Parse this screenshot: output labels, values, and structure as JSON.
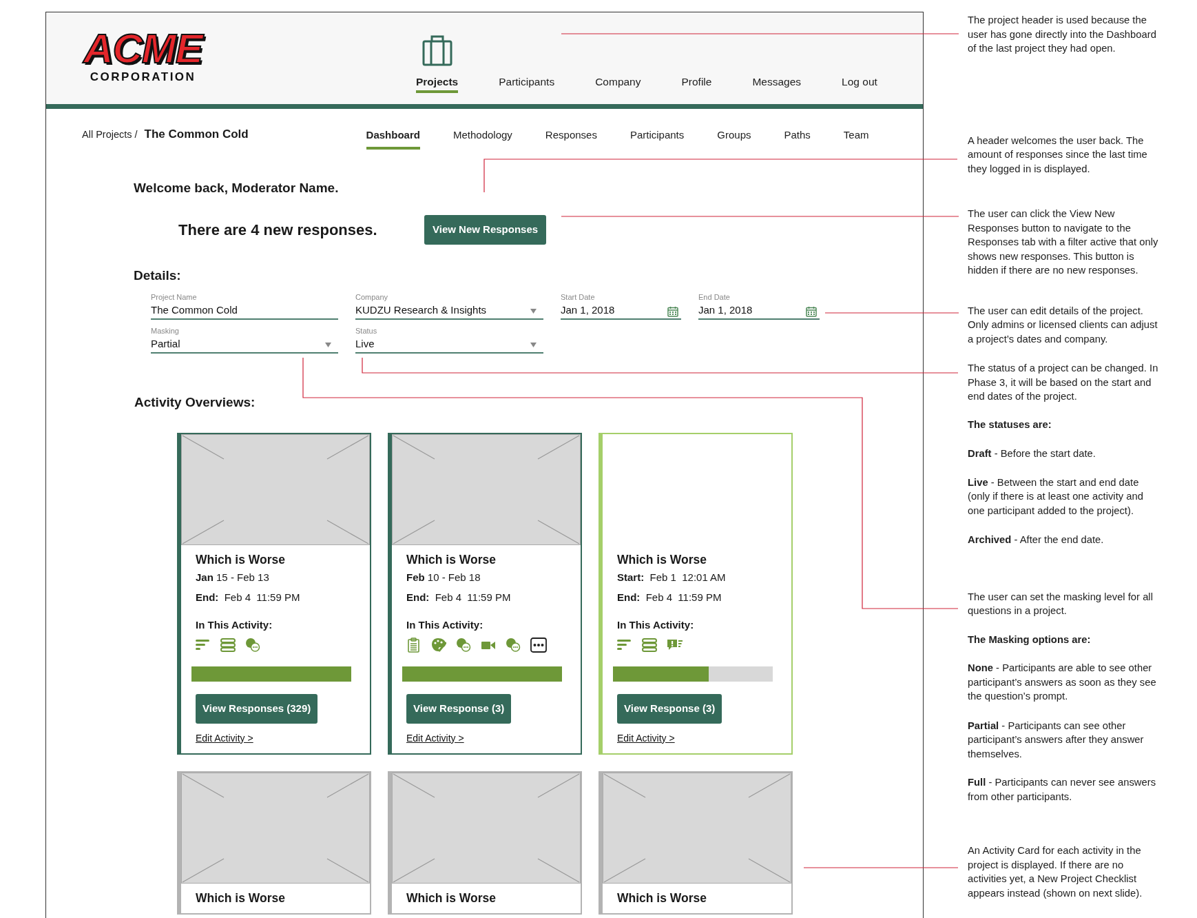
{
  "logo": {
    "line1": "ACME",
    "line2": "CORPORATION"
  },
  "main_nav": [
    {
      "label": "Projects",
      "selected": true
    },
    {
      "label": "Participants",
      "selected": false
    },
    {
      "label": "Company",
      "selected": false
    },
    {
      "label": "Profile",
      "selected": false
    },
    {
      "label": "Messages",
      "selected": false
    },
    {
      "label": "Log out",
      "selected": false
    }
  ],
  "breadcrumb": {
    "parent": "All Projects /",
    "current": "The Common Cold"
  },
  "project_tabs": [
    {
      "label": "Dashboard",
      "selected": true
    },
    {
      "label": "Methodology",
      "selected": false
    },
    {
      "label": "Responses",
      "selected": false
    },
    {
      "label": "Participants",
      "selected": false
    },
    {
      "label": "Groups",
      "selected": false
    },
    {
      "label": "Paths",
      "selected": false
    },
    {
      "label": "Team",
      "selected": false
    }
  ],
  "welcome": "Welcome back, Moderator Name.",
  "new_responses": {
    "text": "There are 4 new responses.",
    "button": "View New Responses"
  },
  "details": {
    "title": "Details:",
    "fields": [
      {
        "label": "Project Name",
        "value": "The Common Cold",
        "kind": "text"
      },
      {
        "label": "Company",
        "value": "KUDZU Research & Insights",
        "kind": "select"
      },
      {
        "label": "Start Date",
        "value": "Jan 1, 2018",
        "kind": "date"
      },
      {
        "label": "End Date",
        "value": "Jan 1, 2018",
        "kind": "date"
      },
      {
        "label": "Masking",
        "value": "Partial",
        "kind": "select"
      },
      {
        "label": "Status",
        "value": "Live",
        "kind": "select"
      }
    ]
  },
  "activity_overviews": {
    "title": "Activity Overviews:",
    "cards": [
      {
        "color": "#356a5a",
        "image": true,
        "title": "Which is Worse",
        "dates": "**Jan** 15 - Feb 13",
        "end": "**End:**  Feb 4  11:59 PM",
        "contents_label": "In This Activity:",
        "icons": [
          {
            "kind": "bars"
          },
          {
            "kind": "stack"
          },
          {
            "kind": "question"
          }
        ],
        "level": 1,
        "button": "View Responses (329)",
        "link": "Edit Activity >"
      },
      {
        "color": "#356a5a",
        "image": true,
        "title": "Which is Worse",
        "dates": "**Feb** 10 - Feb 18",
        "end": "**End:**  Feb 4  11:59 PM",
        "contents_label": "In This Activity:",
        "icons": [
          {
            "kind": "clipboard"
          },
          {
            "kind": "palette"
          },
          {
            "kind": "question"
          },
          {
            "kind": "video"
          },
          {
            "kind": "question"
          },
          {
            "kind": "more"
          }
        ],
        "level": 1,
        "button": "View Response (3)",
        "link": "Edit Activity >"
      },
      {
        "color": "#a5cf6a",
        "image": false,
        "title": "Which is Worse",
        "dates": "**Start:**  Feb 1  12:01 AM",
        "end": "**End:**  Feb 4  11:59 PM",
        "contents_label": "In This Activity:",
        "icons": [
          {
            "kind": "bars"
          },
          {
            "kind": "stack"
          },
          {
            "kind": "alert"
          }
        ],
        "level": 0.6,
        "button": "View Response (3)",
        "link": "Edit Activity >"
      },
      {
        "color": "#b3b3b3",
        "image": true,
        "title": "Which is Worse"
      },
      {
        "color": "#b3b3b3",
        "image": true,
        "title": "Which is Worse"
      },
      {
        "color": "#b3b3b3",
        "image": true,
        "title": "Which is Worse"
      }
    ]
  },
  "notes": [
    {
      "kind": "note",
      "text": "The project header is used because the user has gone directly into the Dashboard of the last project they had open."
    },
    {
      "kind": "note",
      "text": "A header welcomes the user back. The amount of responses since the last time they logged in is displayed."
    },
    {
      "kind": "note",
      "text": "The user can click the View New Responses button to navigate to the Responses tab with a filter active that only shows new responses. This button is hidden if there are no new responses."
    },
    {
      "kind": "note",
      "text": "The user can edit details of the project. Only admins or licensed clients can adjust a project’s dates and company."
    },
    {
      "kind": "note",
      "text": "The status of a project can be changed. In Phase 3, it will be based on the start and end dates of the project."
    },
    {
      "kind": "heading",
      "text": "The statuses are:"
    },
    {
      "kind": "note",
      "text": "**Draft** - Before the start date."
    },
    {
      "kind": "note",
      "text": "**Live** - Between the start and end date (only if there is at least one activity and one participant added to the project)."
    },
    {
      "kind": "note",
      "text": "**Archived** - After the end date."
    },
    {
      "kind": "note",
      "text": "The user can set the masking level for all questions in a project."
    },
    {
      "kind": "heading",
      "text": "The Masking options are:"
    },
    {
      "kind": "note",
      "text": "**None** - Participants are able to see other participant’s answers as soon as they see the question’s prompt."
    },
    {
      "kind": "note",
      "text": "**Partial** - Participants can see other participant’s answers after they answer themselves."
    },
    {
      "kind": "note",
      "text": "**Full** - Participants can never see answers from other participants."
    },
    {
      "kind": "note",
      "text": "An Activity Card for each activity in the project is displayed. If there are no activities yet, a New Project Checklist appears instead (shown on next slide)."
    }
  ]
}
